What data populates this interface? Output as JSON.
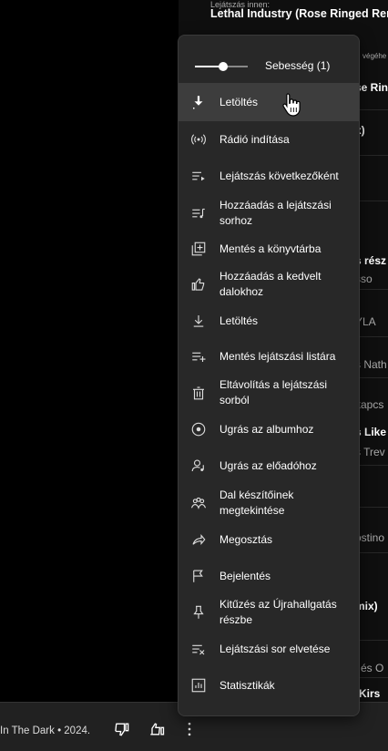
{
  "background": {
    "top_small": "Lejátszás innen:",
    "top_small_right": "végéhe",
    "top_title": "Lethal Industry (Rose Ringed Ren",
    "fragments": [
      {
        "text": "se Rin",
        "style": "b"
      },
      {
        "text": "x)",
        "style": "b"
      },
      {
        "text": "s rész",
        "style": "b"
      },
      {
        "text": "sso",
        "style": "g"
      },
      {
        "text": "YLA",
        "style": "g"
      },
      {
        "text": "s Nath",
        "style": "g"
      },
      {
        "text": "kapcs",
        "style": "g"
      },
      {
        "text": "s Like",
        "style": "b"
      },
      {
        "text": "s Trev",
        "style": "g"
      },
      {
        "text": "ostino",
        "style": "g"
      },
      {
        "text": "mix)",
        "style": "b"
      },
      {
        "text": "r",
        "style": "g"
      },
      {
        "text": "l és O",
        "style": "g"
      },
      {
        "text": "(Kirs",
        "style": "b"
      }
    ]
  },
  "player": {
    "subtitle": "In The Dark • 2024."
  },
  "menu": {
    "speed_label": "Sebesség (1)",
    "speed_value": 1,
    "items": [
      {
        "id": "download-top",
        "label": "Letöltés",
        "icon": "download-arrow-icon",
        "hover": true
      },
      {
        "id": "start-radio",
        "label": "Rádió indítása",
        "icon": "radio-icon"
      },
      {
        "id": "play-next",
        "label": "Lejátszás következőként",
        "icon": "play-next-icon"
      },
      {
        "id": "add-to-queue",
        "label": "Hozzáadás a lejátszási sorhoz",
        "icon": "queue-music-icon"
      },
      {
        "id": "save-library",
        "label": "Mentés a könyvtárba",
        "icon": "library-add-icon"
      },
      {
        "id": "add-liked",
        "label": "Hozzáadás a kedvelt dalokhoz",
        "icon": "thumb-up-icon"
      },
      {
        "id": "download",
        "label": "Letöltés",
        "icon": "download-icon"
      },
      {
        "id": "save-playlist",
        "label": "Mentés lejátszási listára",
        "icon": "playlist-add-icon"
      },
      {
        "id": "remove-queue",
        "label": "Eltávolítás a lejátszási sorból",
        "icon": "trash-icon"
      },
      {
        "id": "go-album",
        "label": "Ugrás az albumhoz",
        "icon": "album-icon"
      },
      {
        "id": "go-artist",
        "label": "Ugrás az előadóhoz",
        "icon": "artist-icon"
      },
      {
        "id": "view-credits",
        "label": "Dal készítőinek megtekintése",
        "icon": "credits-icon"
      },
      {
        "id": "share",
        "label": "Megosztás",
        "icon": "share-icon"
      },
      {
        "id": "report",
        "label": "Bejelentés",
        "icon": "flag-icon"
      },
      {
        "id": "pin-listen-again",
        "label": "Kitűzés az Újrahallgatás részbe",
        "icon": "pin-icon"
      },
      {
        "id": "dismiss-queue",
        "label": "Lejátszási sor elvetése",
        "icon": "clear-queue-icon"
      },
      {
        "id": "stats",
        "label": "Statisztikák",
        "icon": "stats-icon"
      }
    ]
  }
}
